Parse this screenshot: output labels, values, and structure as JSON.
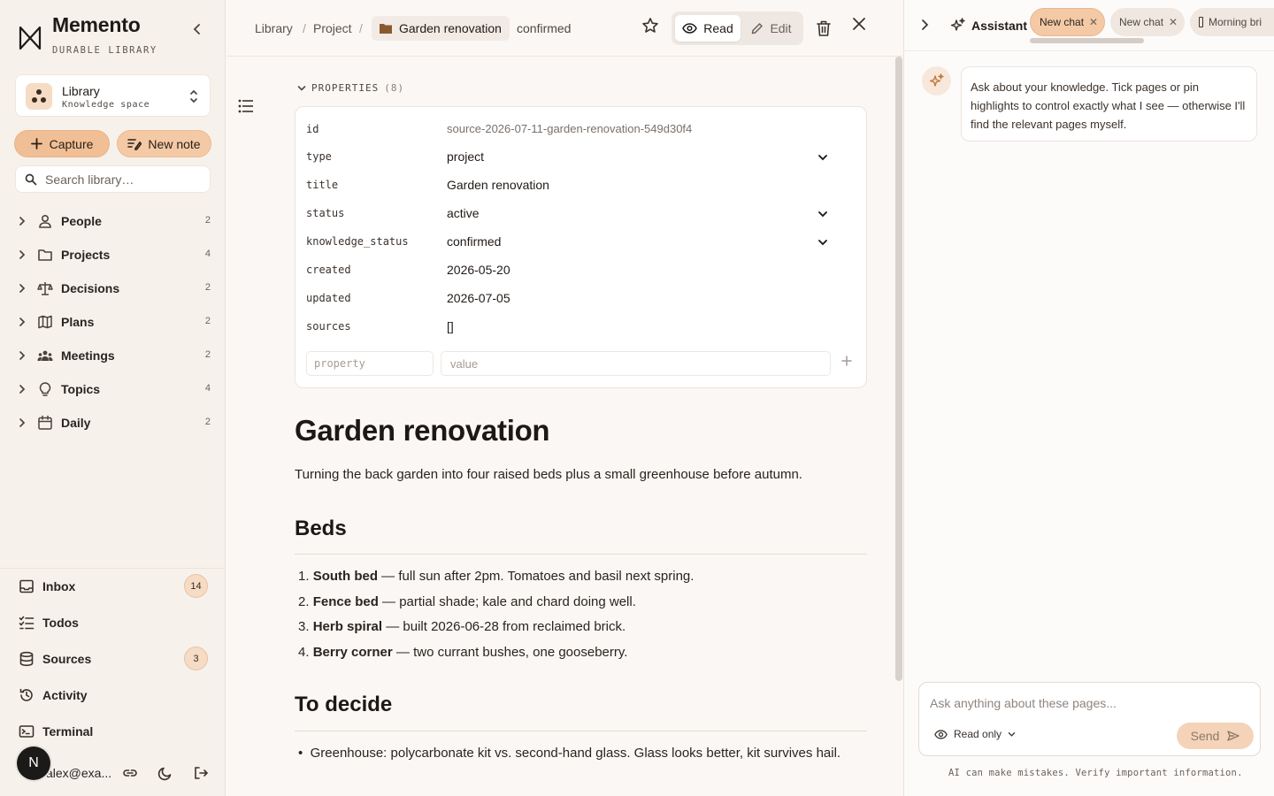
{
  "brand": {
    "name": "Memento",
    "subtitle": "DURABLE LIBRARY"
  },
  "workspace": {
    "title": "Library",
    "subtitle": "Knowledge space"
  },
  "actions": {
    "capture": "Capture",
    "new_note": "New note"
  },
  "search": {
    "placeholder": "Search library…"
  },
  "tree": [
    {
      "label": "People",
      "count": "2",
      "icon": "person-icon"
    },
    {
      "label": "Projects",
      "count": "4",
      "icon": "folder-icon"
    },
    {
      "label": "Decisions",
      "count": "2",
      "icon": "scale-icon"
    },
    {
      "label": "Plans",
      "count": "2",
      "icon": "map-icon"
    },
    {
      "label": "Meetings",
      "count": "2",
      "icon": "group-icon"
    },
    {
      "label": "Topics",
      "count": "4",
      "icon": "lightbulb-icon"
    },
    {
      "label": "Daily",
      "count": "2",
      "icon": "calendar-icon"
    }
  ],
  "bottom_nav": [
    {
      "label": "Inbox",
      "badge": "14",
      "icon": "inbox-icon"
    },
    {
      "label": "Todos",
      "badge": "",
      "icon": "checklist-icon"
    },
    {
      "label": "Sources",
      "badge": "3",
      "icon": "database-icon"
    },
    {
      "label": "Activity",
      "badge": "",
      "icon": "history-icon"
    },
    {
      "label": "Terminal",
      "badge": "",
      "icon": "terminal-icon"
    }
  ],
  "user": {
    "email": "alex@exa...",
    "avatar_letter": "N"
  },
  "breadcrumb": {
    "root": "Library",
    "section": "Project",
    "current": "Garden renovation",
    "status": "confirmed"
  },
  "view_toggle": {
    "read": "Read",
    "edit": "Edit",
    "active": "Read"
  },
  "properties": {
    "header": "PROPERTIES",
    "count": "(8)",
    "rows": [
      {
        "key": "id",
        "value": "source-2026-07-11-garden-renovation-549d30f4",
        "dropdown": false
      },
      {
        "key": "type",
        "value": "project",
        "dropdown": true
      },
      {
        "key": "title",
        "value": "Garden renovation",
        "dropdown": false
      },
      {
        "key": "status",
        "value": "active",
        "dropdown": true
      },
      {
        "key": "knowledge_status",
        "value": "confirmed",
        "dropdown": true
      },
      {
        "key": "created",
        "value": "2026-05-20",
        "dropdown": false
      },
      {
        "key": "updated",
        "value": "2026-07-05",
        "dropdown": false
      },
      {
        "key": "sources",
        "value": "[]",
        "dropdown": false
      }
    ],
    "new_property_placeholder": "property",
    "new_value_placeholder": "value"
  },
  "document": {
    "title": "Garden renovation",
    "intro": "Turning the back garden into four raised beds plus a small greenhouse before autumn.",
    "section1": "Beds",
    "beds": [
      {
        "num": "1.",
        "name": "South bed",
        "text": " — full sun after 2pm. Tomatoes and basil next spring."
      },
      {
        "num": "2.",
        "name": "Fence bed",
        "text": " — partial shade; kale and chard doing well."
      },
      {
        "num": "3.",
        "name": "Herb spiral",
        "text": " — built 2026-06-28 from reclaimed brick."
      },
      {
        "num": "4.",
        "name": "Berry corner",
        "text": " — two currant bushes, one gooseberry."
      }
    ],
    "section2": "To decide",
    "decide": [
      "Greenhouse: polycarbonate kit vs. second-hand glass. Glass looks better, kit survives hail."
    ]
  },
  "assistant": {
    "title": "Assistant",
    "chats": [
      "New chat",
      "New chat",
      "Morning bri"
    ],
    "intro": "Ask about your knowledge. Tick pages or pin highlights to control exactly what I see — otherwise I'll find the relevant pages myself.",
    "input_placeholder": "Ask anything about these pages...",
    "mode": "Read only",
    "send": "Send",
    "disclaimer": "AI can make mistakes. Verify important information."
  },
  "colors": {
    "accent": "#f1bf96",
    "accent_soft": "#f6dcc4",
    "sidebar_bg": "#f7f1ec",
    "page_bg": "#fbf7f4"
  }
}
